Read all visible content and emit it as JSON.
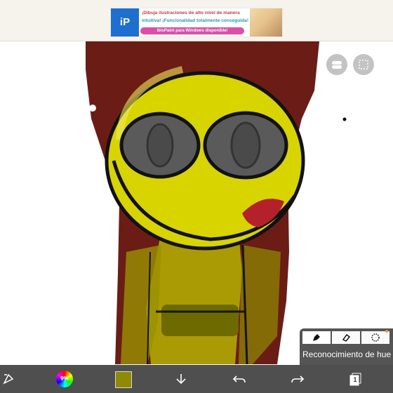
{
  "ad": {
    "line1": "¡Dibuja ilustraciones de alto nivel de manera",
    "line2": "intuitiva! ¡Funcionalidad totalmente conseguida!",
    "cta": "ibisPaint para Windows disponible!",
    "logo_text": "iP"
  },
  "canvas": {
    "background": "#ffffff",
    "subject_colors": {
      "face": "#d8d400",
      "outline": "#111111",
      "body_dark": "#6b1c14",
      "eyes": "#5a5a5a"
    }
  },
  "overlay_buttons": [
    {
      "name": "transform-toggle-button",
      "icon": "toggle-switch-icon"
    },
    {
      "name": "layer-grid-button",
      "icon": "grid-icon"
    }
  ],
  "brush_panel": {
    "tools": [
      "pen-tool",
      "eraser-tool",
      "blur-tool"
    ],
    "label": "Reconocimiento de hue"
  },
  "toolbar": {
    "color_wheel_label": "9%",
    "current_color": "#8f8a00",
    "layer_count": "1",
    "items": [
      "tool-select-icon",
      "color-wheel",
      "color-swatch",
      "download-arrow-icon",
      "undo-icon",
      "redo-icon",
      "layers-icon"
    ]
  }
}
